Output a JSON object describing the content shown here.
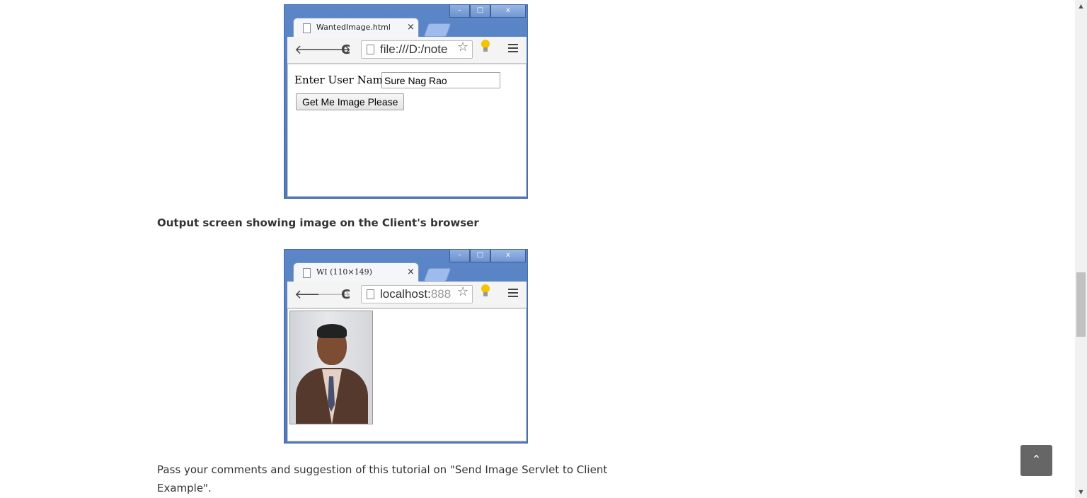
{
  "window1": {
    "tab_title": "WantedImage.html",
    "tab_close": "×",
    "url": "file:///D:/note",
    "win_ctrls": [
      "–",
      "□",
      "x"
    ],
    "form": {
      "label": "Enter User Name",
      "input_value": "Sure Nag Rao",
      "button_label": "Get Me Image Please"
    }
  },
  "caption": "Output screen showing image on the Client's browser",
  "window2": {
    "tab_title": "WI (110×149)",
    "tab_close": "×",
    "url_host": "localhost:",
    "url_port": "888",
    "win_ctrls": [
      "–",
      "□",
      "x"
    ]
  },
  "paragraph": "Pass your comments and suggestion of this tutorial on \"Send Image Servlet to Client Example\".",
  "scroll_to_top": "⌃",
  "nav_icons": {
    "back": "🡐",
    "forward": "🡒",
    "reload": "C",
    "star": "☆"
  },
  "colors": {
    "window_frame": "#4d78bb",
    "text": "#333333",
    "to_top_bg": "#666666"
  }
}
